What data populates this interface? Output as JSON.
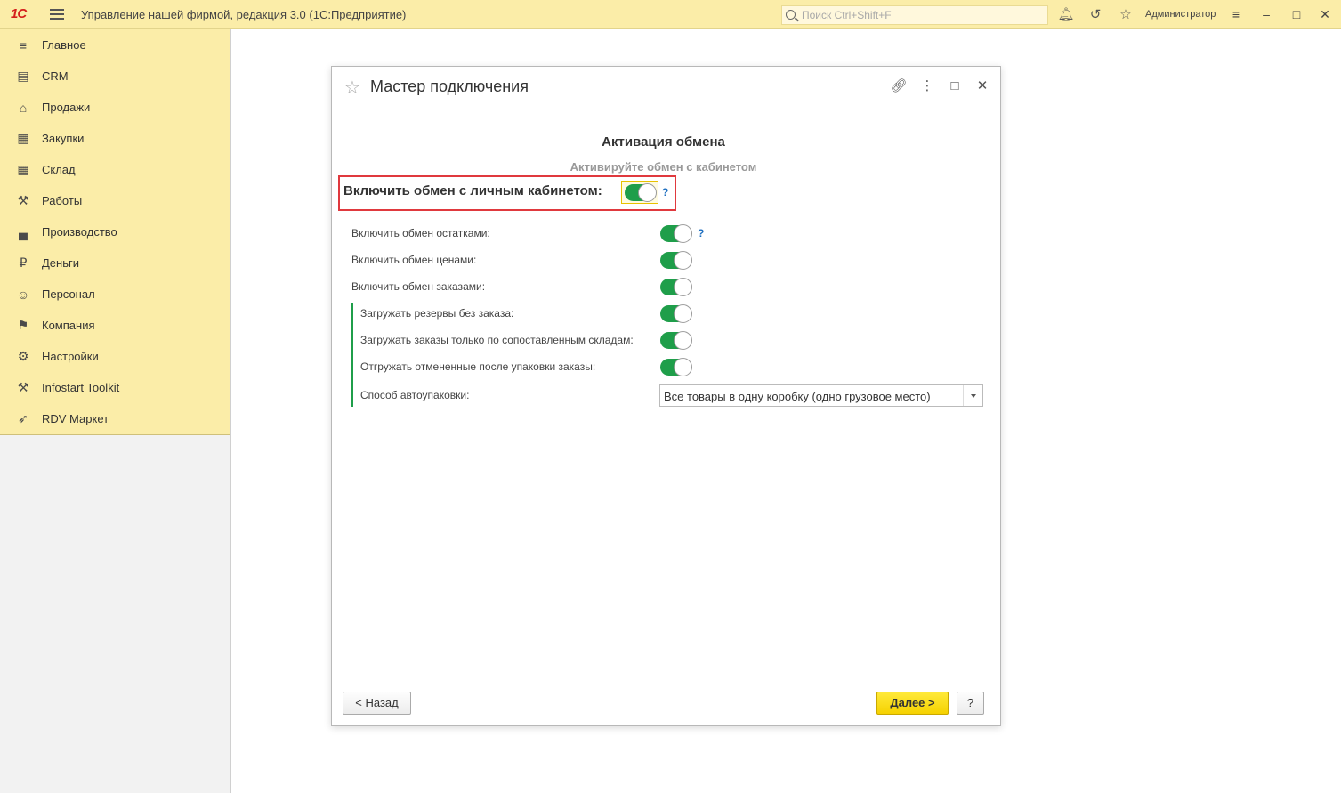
{
  "app": {
    "logo": "1С",
    "title": "Управление нашей фирмой, редакция 3.0  (1С:Предприятие)",
    "search_placeholder": "Поиск Ctrl+Shift+F",
    "user": "Администратор"
  },
  "sidebar": {
    "items": [
      {
        "label": "Главное",
        "icon": "hamburger-icon"
      },
      {
        "label": "CRM",
        "icon": "contact-card-icon"
      },
      {
        "label": "Продажи",
        "icon": "basket-icon"
      },
      {
        "label": "Закупки",
        "icon": "cart-icon"
      },
      {
        "label": "Склад",
        "icon": "warehouse-grid-icon"
      },
      {
        "label": "Работы",
        "icon": "tools-icon"
      },
      {
        "label": "Производство",
        "icon": "factory-icon"
      },
      {
        "label": "Деньги",
        "icon": "ruble-coin-icon"
      },
      {
        "label": "Персонал",
        "icon": "people-icon"
      },
      {
        "label": "Компания",
        "icon": "flag-icon"
      },
      {
        "label": "Настройки",
        "icon": "gear-icon"
      },
      {
        "label": "Infostart Toolkit",
        "icon": "wrench-icon"
      },
      {
        "label": "RDV Маркет",
        "icon": "rocket-icon"
      }
    ]
  },
  "dialog": {
    "title": "Мастер подключения",
    "heading": "Активация обмена",
    "subheading": "Активируйте обмен с кабинетом",
    "main_toggle": {
      "label": "Включить обмен с личным кабинетом:",
      "on": true
    },
    "help": "?",
    "toggles": [
      {
        "label": "Включить обмен остатками:",
        "on": true,
        "help": true
      },
      {
        "label": "Включить обмен ценами:",
        "on": true
      },
      {
        "label": "Включить обмен заказами:",
        "on": true
      },
      {
        "label": "Загружать резервы без заказа:",
        "on": true
      },
      {
        "label": "Загружать заказы только по сопоставленным складам:",
        "on": true
      },
      {
        "label": "Отгружать отмененные после упаковки заказы:",
        "on": true
      }
    ],
    "autopack": {
      "label": "Способ автоупаковки:",
      "value": "Все товары в одну коробку (одно грузовое место)"
    },
    "buttons": {
      "back": "< Назад",
      "next": "Далее >",
      "help": "?"
    }
  },
  "colors": {
    "accent_yellow": "#fbeda8",
    "toggle_green": "#1f9e4a",
    "highlight_red": "#e0393e",
    "primary_button": "#f5d100"
  }
}
